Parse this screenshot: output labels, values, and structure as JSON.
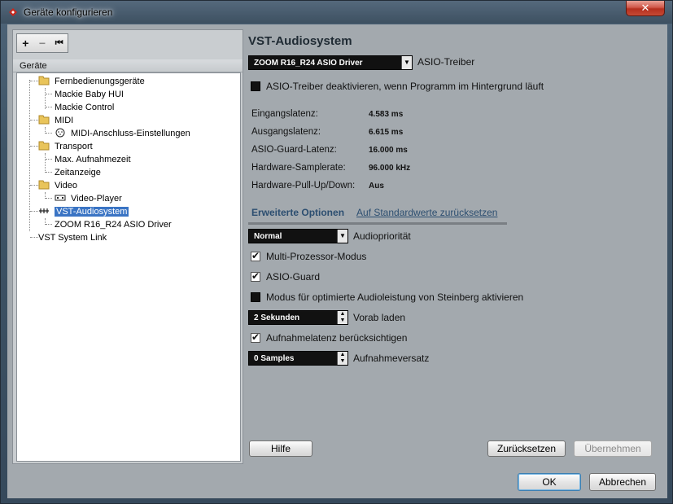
{
  "window": {
    "title": "Geräte konfigurieren",
    "close_label": "✕"
  },
  "toolbar": {
    "add_label": "+",
    "remove_label": "−",
    "reset_label": "⏮"
  },
  "tree": {
    "header": "Geräte",
    "items": [
      {
        "label": "Fernbedienungsgeräte",
        "icon": "folder-icon"
      },
      {
        "label": "Mackie Baby HUI"
      },
      {
        "label": "Mackie Control"
      },
      {
        "label": "MIDI",
        "icon": "folder-icon"
      },
      {
        "label": "MIDI-Anschluss-Einstellungen",
        "icon": "midi-port-icon"
      },
      {
        "label": "Transport",
        "icon": "folder-icon"
      },
      {
        "label": "Max. Aufnahmezeit"
      },
      {
        "label": "Zeitanzeige"
      },
      {
        "label": "Video",
        "icon": "folder-icon"
      },
      {
        "label": "Video-Player",
        "icon": "video-icon"
      },
      {
        "label": "VST-Audiosystem",
        "icon": "vst-icon",
        "selected": true
      },
      {
        "label": "ZOOM R16_R24 ASIO Driver"
      },
      {
        "label": "VST System Link"
      }
    ]
  },
  "panel": {
    "heading": "VST-Audiosystem",
    "driver_select": "ZOOM R16_R24 ASIO Driver",
    "driver_label": "ASIO-Treiber",
    "deactivate_label": "ASIO-Treiber deaktivieren, wenn Programm im Hintergrund läuft",
    "deactivate_checked": false,
    "info": [
      {
        "label": "Eingangslatenz:",
        "value": "4.583 ms"
      },
      {
        "label": "Ausgangslatenz:",
        "value": "6.615 ms"
      },
      {
        "label": "ASIO-Guard-Latenz:",
        "value": "16.000 ms"
      },
      {
        "label": "Hardware-Samplerate:",
        "value": "96.000 kHz"
      },
      {
        "label": "Hardware-Pull-Up/Down:",
        "value": "Aus"
      }
    ],
    "tab_active": "Erweiterte Optionen",
    "tab_reset_link": "Auf Standardwerte zurücksetzen",
    "priority_select": "Normal",
    "priority_label": "Audiopriorität",
    "multiprocessor_label": "Multi-Prozessor-Modus",
    "multiprocessor_checked": true,
    "asioguard_label": "ASIO-Guard",
    "asioguard_checked": true,
    "steinberg_label": "Modus für optimierte Audioleistung von Steinberg aktivieren",
    "steinberg_checked": false,
    "preload_value": "2 Sekunden",
    "preload_label": "Vorab laden",
    "reclatency_label": "Aufnahmelatenz berücksichtigen",
    "reclatency_checked": true,
    "recoffset_value": "0 Samples",
    "recoffset_label": "Aufnahmeversatz"
  },
  "buttons": {
    "help": "Hilfe",
    "reset": "Zurücksetzen",
    "apply": "Übernehmen",
    "ok": "OK",
    "cancel": "Abbrechen"
  },
  "colors": {
    "selection": "#3a74c4",
    "link": "#2c4e70",
    "close_button": "#c44a36"
  }
}
